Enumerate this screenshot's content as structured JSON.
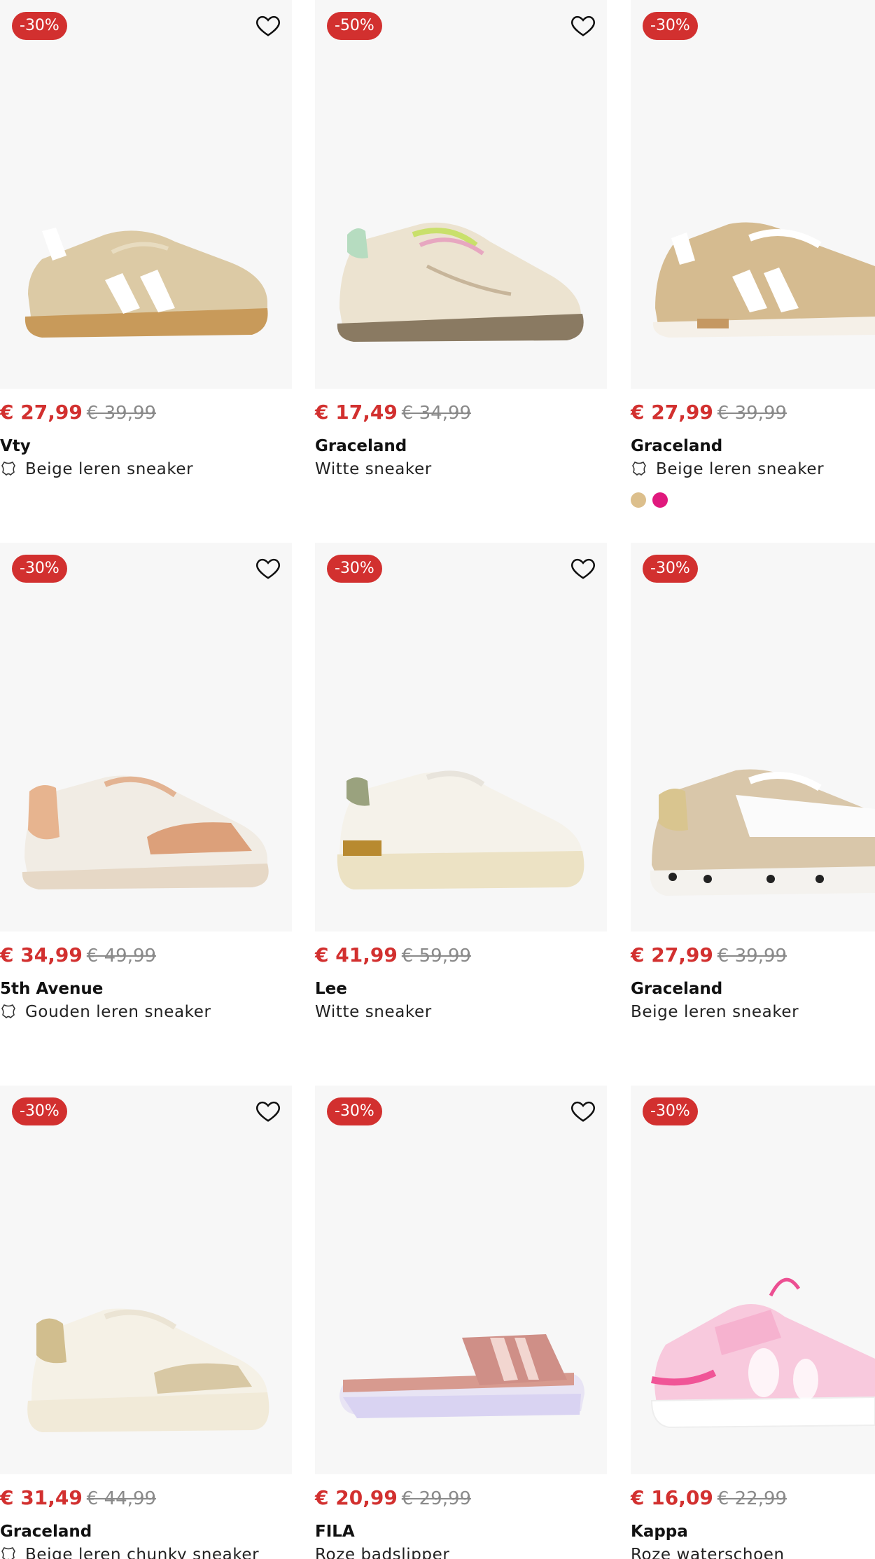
{
  "colors": {
    "sale": "#d2302f",
    "old_price": "#8a8a8a"
  },
  "products": [
    {
      "badge": "-30%",
      "price": "€ 27,99",
      "old_price": "€ 39,99",
      "brand": "Vty",
      "title": "Beige leren sneaker",
      "leather_icon": "leaf-icon",
      "swatches": []
    },
    {
      "badge": "-50%",
      "price": "€ 17,49",
      "old_price": "€ 34,99",
      "brand": "Graceland",
      "title": "Witte sneaker",
      "leather_icon": "",
      "swatches": []
    },
    {
      "badge": "-30%",
      "price": "€ 27,99",
      "old_price": "€ 39,99",
      "brand": "Graceland",
      "title": "Beige leren sneaker",
      "leather_icon": "leaf-icon",
      "swatches": [
        "#dcbf8c",
        "#e0197d"
      ]
    },
    {
      "badge": "-30%",
      "price": "€ 34,99",
      "old_price": "€ 49,99",
      "brand": "5th Avenue",
      "title": "Gouden leren sneaker",
      "leather_icon": "leaf-icon",
      "swatches": []
    },
    {
      "badge": "-30%",
      "price": "€ 41,99",
      "old_price": "€ 59,99",
      "brand": "Lee",
      "title": "Witte sneaker",
      "leather_icon": "",
      "swatches": []
    },
    {
      "badge": "-30%",
      "price": "€ 27,99",
      "old_price": "€ 39,99",
      "brand": "Graceland",
      "title": "Beige leren sneaker",
      "leather_icon": "",
      "swatches": []
    },
    {
      "badge": "-30%",
      "price": "€ 31,49",
      "old_price": "€ 44,99",
      "brand": "Graceland",
      "title": "Beige leren chunky sneaker",
      "leather_icon": "leaf-icon",
      "swatches": []
    },
    {
      "badge": "-30%",
      "price": "€ 20,99",
      "old_price": "€ 29,99",
      "brand": "FILA",
      "title": "Roze badslipper",
      "leather_icon": "",
      "swatches": []
    },
    {
      "badge": "-30%",
      "price": "€ 16,09",
      "old_price": "€ 22,99",
      "brand": "Kappa",
      "title": "Roze waterschoen",
      "leather_icon": "",
      "swatches": []
    }
  ]
}
